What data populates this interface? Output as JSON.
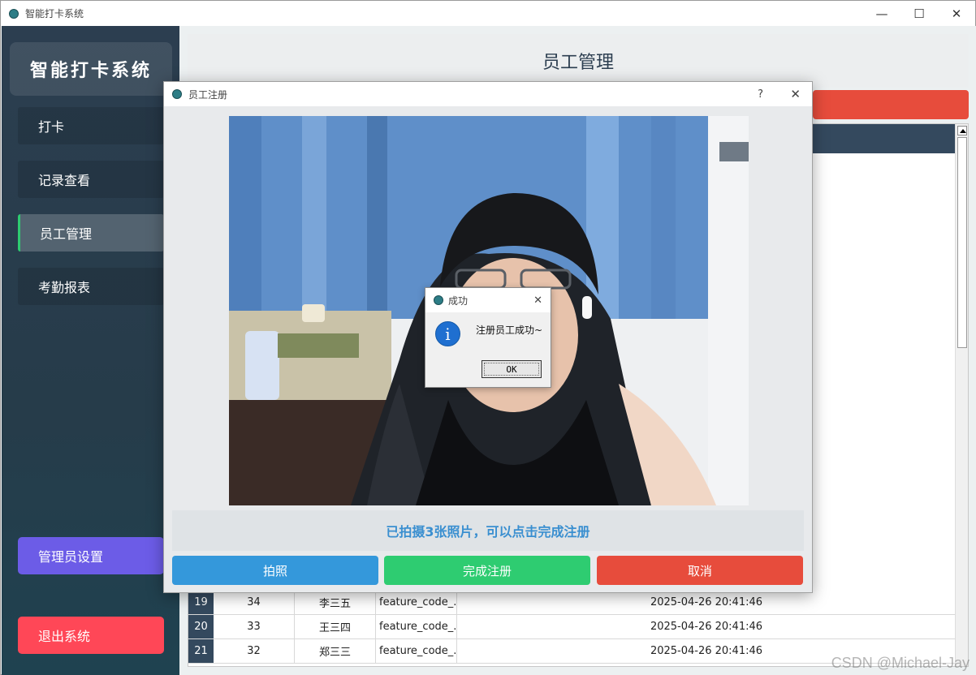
{
  "window": {
    "title": "智能打卡系统",
    "controls": {
      "minimize": "—",
      "maximize": "☐",
      "close": "✕"
    }
  },
  "sidebar": {
    "brand": "智能打卡系统",
    "items": [
      {
        "label": "打卡"
      },
      {
        "label": "记录查看"
      },
      {
        "label": "员工管理",
        "active": true
      },
      {
        "label": "考勤报表"
      }
    ],
    "admin_button": "管理员设置",
    "exit_button": "退出系统"
  },
  "main": {
    "page_title": "员工管理",
    "table": {
      "rows": [
        {
          "num": "19",
          "id": "34",
          "name": "李三五",
          "feature": "feature_code_...",
          "time": "2025-04-26 20:41:46"
        },
        {
          "num": "20",
          "id": "33",
          "name": "王三四",
          "feature": "feature_code_...",
          "time": "2025-04-26 20:41:46"
        },
        {
          "num": "21",
          "id": "32",
          "name": "郑三三",
          "feature": "feature_code_...",
          "time": "2025-04-26 20:41:46"
        }
      ]
    }
  },
  "register_dialog": {
    "title": "员工注册",
    "help": "?",
    "close": "✕",
    "status": "已拍摄3张照片，可以点击完成注册",
    "buttons": {
      "capture": "拍照",
      "finish": "完成注册",
      "cancel": "取消"
    }
  },
  "message_box": {
    "title": "成功",
    "close": "✕",
    "icon": "i",
    "text": "注册员工成功~",
    "ok": "OK"
  },
  "watermark": "CSDN @Michael-Jay",
  "colors": {
    "sidebar_bg": "#2c3e50",
    "active_accent": "#2ecc71",
    "admin_button": "#6c5ce7",
    "exit_button": "#ff4757",
    "capture_button": "#3498db",
    "finish_button": "#2ecc71",
    "cancel_button": "#e74c3c",
    "status_text": "#3a8fd0",
    "info_icon": "#1f6fd0"
  }
}
